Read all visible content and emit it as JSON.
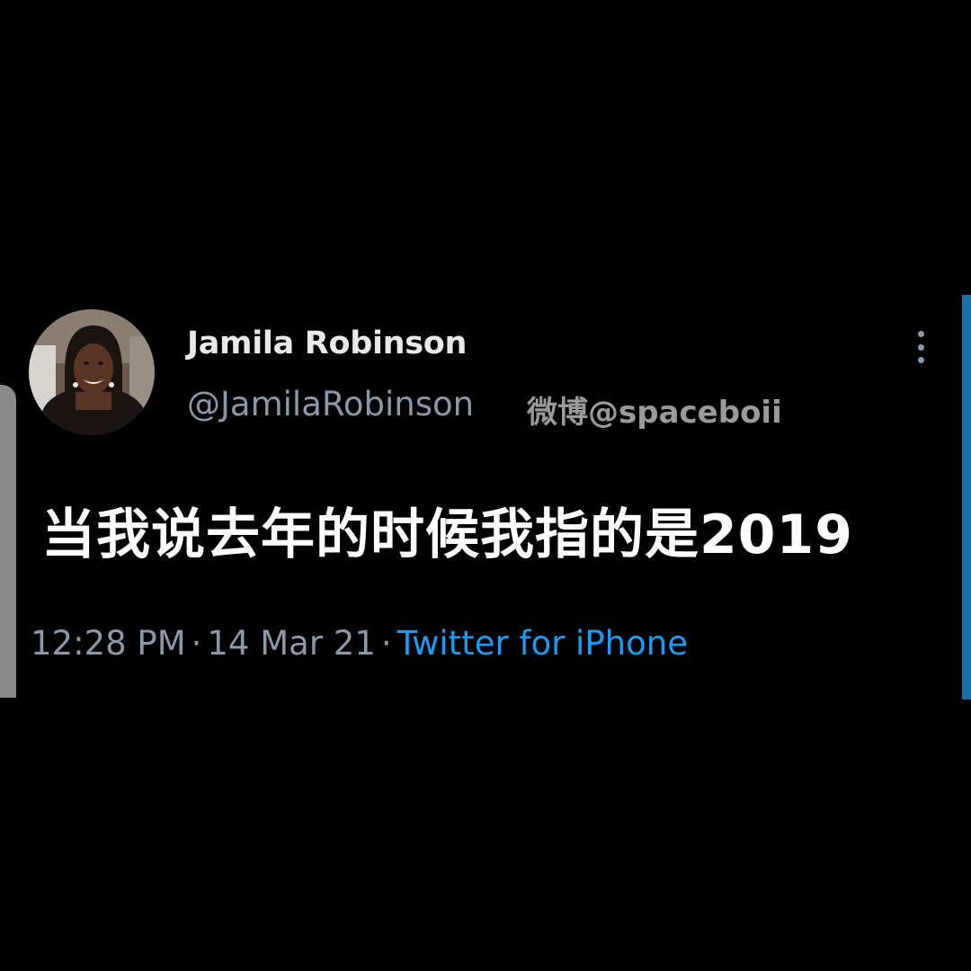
{
  "tweet": {
    "display_name": "Jamila Robinson",
    "handle": "@JamilaRobinson",
    "watermark": "微博@spaceboii",
    "text": "当我说去年的时候我指的是2019",
    "time": "12:28 PM",
    "separator": "·",
    "date": "14 Mar 21",
    "source": "Twitter for iPhone"
  },
  "icons": {
    "more": "more-vertical-icon",
    "avatar": "profile-photo"
  },
  "colors": {
    "background": "#000000",
    "text": "#ffffff",
    "secondary_text": "#8b98a5",
    "link": "#1d9bf0",
    "edge_accent": "#1d6fa8"
  }
}
